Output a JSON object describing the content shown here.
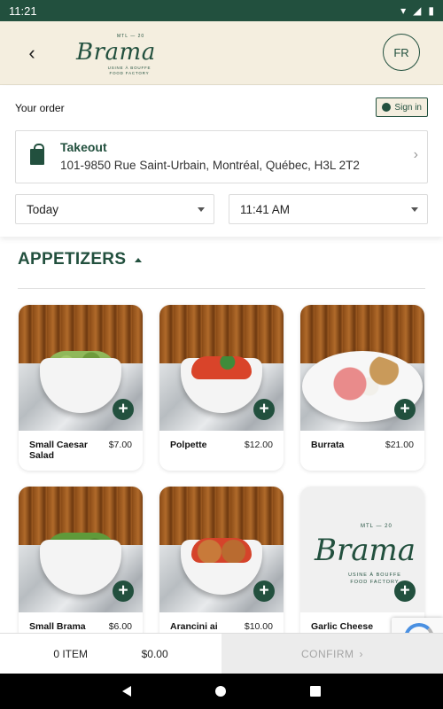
{
  "status_bar": {
    "time": "11:21",
    "icons": [
      "wifi-icon",
      "signal-icon",
      "battery-icon"
    ]
  },
  "header": {
    "logo": {
      "word": "Brama",
      "top": "MTL — 20",
      "subtitle": "USINE À BOUFFE FOOD FACTORY"
    },
    "language_button": "FR"
  },
  "order": {
    "label": "Your order",
    "sign_in": "Sign in",
    "takeout": {
      "title": "Takeout",
      "address": "101-9850 Rue Saint-Urbain, Montréal, Québec, H3L 2T2"
    },
    "day": "Today",
    "time": "11:41 AM"
  },
  "section": {
    "title": "APPETIZERS"
  },
  "products": [
    {
      "name": "Small Caesar Salad",
      "price": "$7.00",
      "image": "salad"
    },
    {
      "name": "Polpette",
      "price": "$12.00",
      "image": "tomato"
    },
    {
      "name": "Burrata",
      "price": "$21.00",
      "image": "burrata"
    },
    {
      "name": "Small Brama",
      "price": "$6.00",
      "image": "greens"
    },
    {
      "name": "Arancini ai",
      "price": "$10.00",
      "image": "balls"
    },
    {
      "name": "Garlic Cheese",
      "price": "",
      "image": "logo"
    }
  ],
  "cart": {
    "items": "0 ITEM",
    "total": "$0.00",
    "confirm": "CONFIRM"
  },
  "colors": {
    "brand": "#22503e",
    "header_bg": "#f4eedf"
  }
}
